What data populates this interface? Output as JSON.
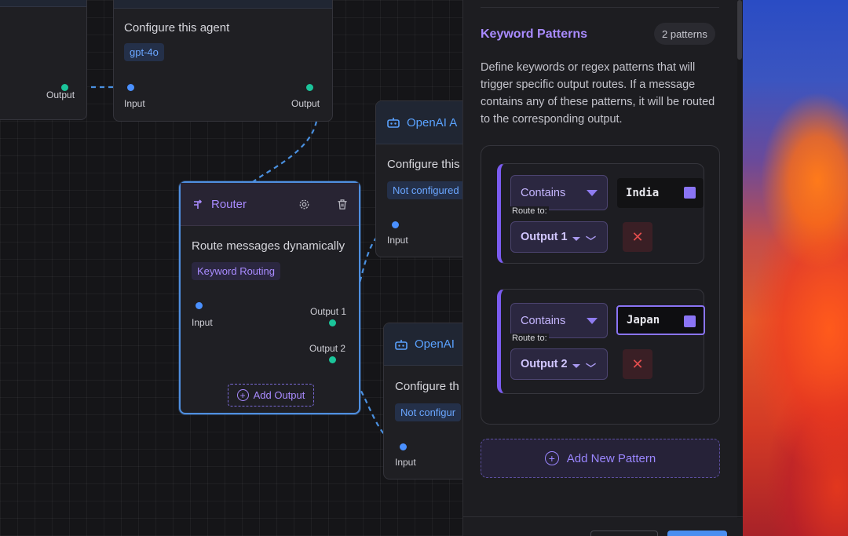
{
  "canvas": {
    "node_top_left": {
      "output_label": "Output"
    },
    "node_agent_top": {
      "description": "Configure this agent",
      "model": "gpt-4o",
      "input_label": "Input",
      "output_label": "Output"
    },
    "node_openai_1": {
      "title": "OpenAI A",
      "description": "Configure this",
      "chip": "Not configured",
      "input_label": "Input"
    },
    "node_openai_2": {
      "title": "OpenAI",
      "description": "Configure th",
      "chip": "Not configur",
      "input_label": "Input"
    },
    "router": {
      "title": "Router",
      "description": "Route messages dynamically",
      "chip": "Keyword Routing",
      "input_label": "Input",
      "output1_label": "Output 1",
      "output2_label": "Output 2",
      "add_output_label": "Add Output"
    }
  },
  "panel": {
    "title": "Keyword Patterns",
    "count_badge": "2 patterns",
    "description": "Define keywords or regex patterns that will trigger specific output routes. If a message contains any of these patterns, it will be routed to the corresponding output.",
    "patterns": [
      {
        "match_type": "Contains",
        "keyword": "India",
        "route_to_label": "Route to:",
        "route": "Output 1"
      },
      {
        "match_type": "Contains",
        "keyword": "Japan",
        "route_to_label": "Route to:",
        "route": "Output 2"
      }
    ],
    "add_pattern_label": "Add New Pattern"
  },
  "colors": {
    "accent_purple": "#a98bff",
    "accent_blue": "#5aa2ff",
    "port_input": "#4a90ff",
    "port_output": "#1bc49a",
    "danger": "#e24d4d"
  }
}
